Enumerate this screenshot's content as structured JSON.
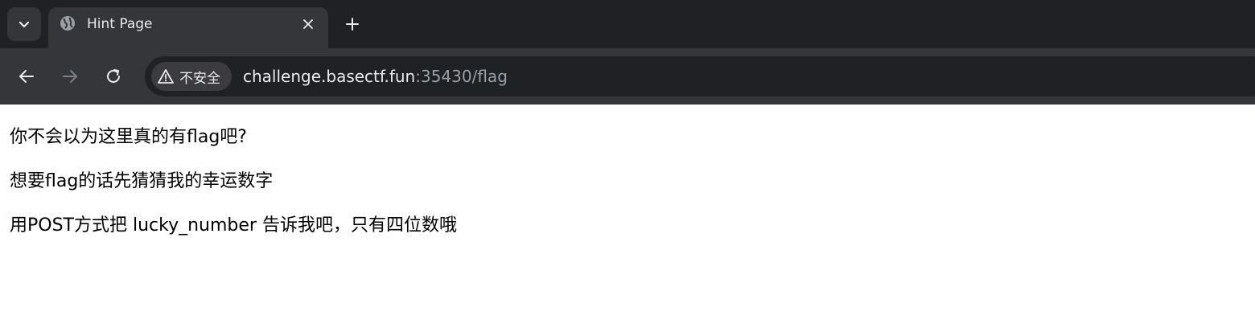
{
  "browser": {
    "tab": {
      "title": "Hint Page",
      "favicon_icon": "globe-icon"
    },
    "toolbar": {
      "security_label": "不安全",
      "url_host": "challenge.basectf.fun",
      "url_path": ":35430/flag"
    },
    "colors": {
      "tabstrip_bg": "#202124",
      "toolbar_bg": "#35363a",
      "omnibox_bg": "#202124",
      "text": "#e8eaed",
      "dim_text": "#9aa0a6"
    }
  },
  "page": {
    "lines": [
      "你不会以为这里真的有flag吧?",
      "想要flag的话先猜猜我的幸运数字",
      "用POST方式把 lucky_number 告诉我吧，只有四位数哦"
    ]
  }
}
